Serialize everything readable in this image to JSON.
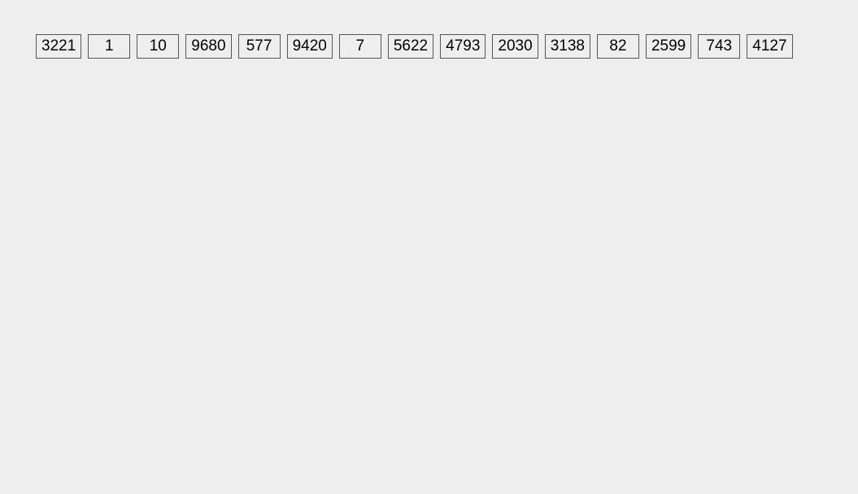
{
  "numbers": [
    "3221",
    "1",
    "10",
    "9680",
    "577",
    "9420",
    "7",
    "5622",
    "4793",
    "2030",
    "3138",
    "82",
    "2599",
    "743",
    "4127"
  ]
}
